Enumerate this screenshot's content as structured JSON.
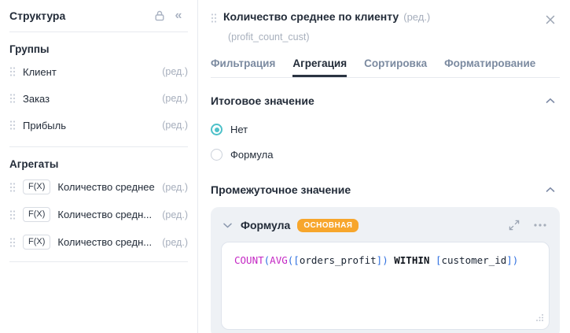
{
  "colors": {
    "accent_teal": "#4ec1c9",
    "badge_orange": "#f7a62c",
    "code_function": "#c428c4",
    "code_bracket": "#2e6fe0",
    "tab_inactive": "#7b8aa0",
    "text_dark": "#232c39",
    "muted_gray": "#a6aebc"
  },
  "sidebar": {
    "title": "Структура",
    "collapse_glyph": "«",
    "groups_header": "Группы",
    "groups": [
      {
        "label": "Клиент",
        "edit": "(ред.)"
      },
      {
        "label": "Заказ",
        "edit": "(ред.)"
      },
      {
        "label": "Прибыль",
        "edit": "(ред.)"
      }
    ],
    "aggregates_header": "Агрегаты",
    "aggregates": [
      {
        "badge": "F(X)",
        "label": "Количество среднее",
        "edit": "(ред.)"
      },
      {
        "badge": "F(X)",
        "label": "Количество средн...",
        "edit": "(ред.)"
      },
      {
        "badge": "F(X)",
        "label": "Количество средн...",
        "edit": "(ред.)"
      }
    ]
  },
  "panel": {
    "title": "Количество среднее по клиенту",
    "title_edit": "(ред.)",
    "subtitle": "(profit_count_cust)",
    "tabs": [
      {
        "label": "Фильтрация"
      },
      {
        "label": "Агрегация"
      },
      {
        "label": "Сортировка"
      },
      {
        "label": "Форматирование"
      }
    ],
    "total_section": {
      "title": "Итоговое значение",
      "options": [
        {
          "label": "Нет",
          "selected": true
        },
        {
          "label": "Формула",
          "selected": false
        }
      ]
    },
    "intermediate_section": {
      "title": "Промежуточное значение",
      "formula_card": {
        "title": "Формула",
        "badge": "ОСНОВНАЯ",
        "code_text": "COUNT(AVG([orders_profit]) WITHIN [customer_id])",
        "code_tokens": [
          {
            "text": "COUNT",
            "type": "func"
          },
          {
            "text": "(",
            "type": "bracket"
          },
          {
            "text": "AVG",
            "type": "func"
          },
          {
            "text": "(",
            "type": "bracket"
          },
          {
            "text": "[",
            "type": "bracket"
          },
          {
            "text": "orders_profit",
            "type": "field"
          },
          {
            "text": "]",
            "type": "bracket"
          },
          {
            "text": ")",
            "type": "bracket"
          },
          {
            "text": " WITHIN ",
            "type": "keyword"
          },
          {
            "text": "[",
            "type": "bracket"
          },
          {
            "text": "customer_id",
            "type": "field"
          },
          {
            "text": "]",
            "type": "bracket"
          },
          {
            "text": ")",
            "type": "bracket"
          }
        ]
      }
    }
  }
}
